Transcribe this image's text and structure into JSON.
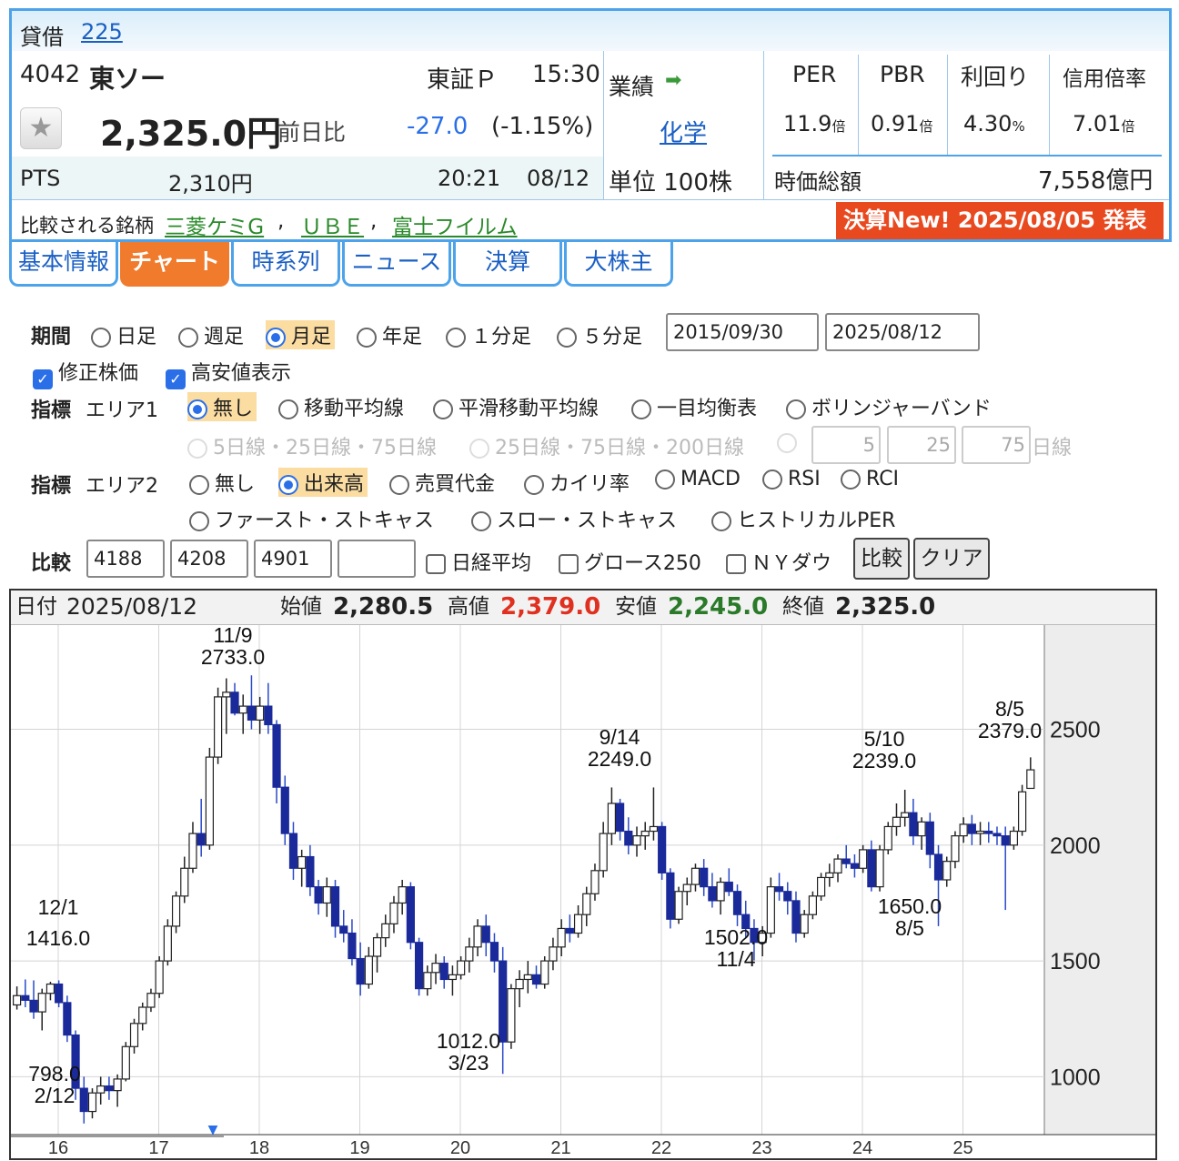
{
  "header": {
    "loan_label": "貸借",
    "index_link": "225",
    "code": "4042",
    "name": "東ソー",
    "market": "東証Ｐ",
    "time": "15:30",
    "price": "2,325.0円",
    "change_label": "前日比",
    "change": "-27.0",
    "change_pct": "(-1.15%)",
    "pts_label": "PTS",
    "pts_price": "2,310円",
    "pts_time": "20:21",
    "pts_date": "08/12",
    "perf_label": "業績",
    "sector": "化学",
    "unit": "単位 100株",
    "per_label": "PER",
    "pbr_label": "PBR",
    "yield_label": "利回り",
    "margin_label": "信用倍率",
    "per": "11.9",
    "pbr": "0.91",
    "yield": "4.30",
    "margin": "7.01",
    "bai": "倍",
    "pct": "%",
    "mcap_label": "時価総額",
    "mcap": "7,558億円",
    "compare_label": "比較される銘柄",
    "peer1": "三菱ケミG",
    "peer2": "ＵＢＥ",
    "peer3": "富士フイルム",
    "sep": ",",
    "earnings": "決算New! 2025/08/05 発表"
  },
  "tabs": [
    "基本情報",
    "チャート",
    "時系列",
    "ニュース",
    "決算",
    "大株主"
  ],
  "controls": {
    "period_label": "期間",
    "periods": [
      "日足",
      "週足",
      "月足",
      "年足",
      "１分足",
      "５分足"
    ],
    "date_from": "2015/09/30",
    "date_to": "2025/08/12",
    "adjusted": "修正株価",
    "highlow": "高安値表示",
    "indicator_label": "指標",
    "area1": "エリア1",
    "area1_opts": [
      "無し",
      "移動平均線",
      "平滑移動平均線",
      "一目均衡表",
      "ボリンジャーバンド"
    ],
    "ma_set1": "5日線・25日線・75日線",
    "ma_set2": "25日線・75日線・200日線",
    "ma1": "5",
    "ma2": "25",
    "ma3": "75",
    "ma_unit": "日線",
    "area2": "エリア2",
    "area2_opts": [
      "無し",
      "出来高",
      "売買代金",
      "カイリ率",
      "MACD",
      "RSI",
      "RCI"
    ],
    "area2_opts2": [
      "ファースト・ストキャス",
      "スロー・ストキャス",
      "ヒストリカルPER"
    ],
    "compare_label": "比較",
    "cmp1": "4188",
    "cmp2": "4208",
    "cmp3": "4901",
    "cmp4": "",
    "nikkei": "日経平均",
    "growth": "グロース250",
    "ny": "ＮＹダウ",
    "compare_btn": "比較",
    "clear_btn": "クリア"
  },
  "ohlc_bar": {
    "date_label": "日付",
    "date": "2025/08/12",
    "open_label": "始値",
    "open": "2,280.5",
    "high_label": "高値",
    "high": "2,379.0",
    "low_label": "安値",
    "low": "2,245.0",
    "close_label": "終値",
    "close": "2,325.0"
  },
  "chart_data": {
    "type": "candlestick",
    "ylim": [
      750,
      2950
    ],
    "yticks": [
      1000,
      1500,
      2000,
      2500
    ],
    "xticks": [
      "16",
      "17",
      "18",
      "19",
      "20",
      "21",
      "22",
      "23",
      "24",
      "25"
    ],
    "annotations": [
      {
        "date": "12/1",
        "value": "1416.0"
      },
      {
        "date": "2/12",
        "value": "798.0"
      },
      {
        "date": "11/9",
        "value": "2733.0"
      },
      {
        "date": "3/23",
        "value": "1012.0"
      },
      {
        "date": "9/14",
        "value": "2249.0"
      },
      {
        "date": "11/4",
        "value": "1502.0"
      },
      {
        "date": "5/10",
        "value": "2239.0"
      },
      {
        "date": "8/5",
        "value": "1650.0"
      },
      {
        "date": "8/5",
        "value": "2379.0"
      }
    ],
    "monthly_ohlc": [
      [
        1310,
        1390,
        1290,
        1350
      ],
      [
        1350,
        1420,
        1300,
        1330
      ],
      [
        1330,
        1416,
        1250,
        1280
      ],
      [
        1280,
        1380,
        1200,
        1360
      ],
      [
        1360,
        1410,
        1330,
        1400
      ],
      [
        1400,
        1416,
        1300,
        1320
      ],
      [
        1320,
        1350,
        1150,
        1180
      ],
      [
        1180,
        1200,
        900,
        950
      ],
      [
        950,
        1000,
        798,
        850
      ],
      [
        850,
        950,
        820,
        930
      ],
      [
        930,
        1000,
        880,
        960
      ],
      [
        960,
        1000,
        900,
        940
      ],
      [
        940,
        1010,
        870,
        990
      ],
      [
        990,
        1150,
        980,
        1130
      ],
      [
        1130,
        1250,
        1100,
        1230
      ],
      [
        1230,
        1320,
        1200,
        1300
      ],
      [
        1300,
        1380,
        1280,
        1360
      ],
      [
        1360,
        1520,
        1340,
        1500
      ],
      [
        1500,
        1680,
        1480,
        1650
      ],
      [
        1650,
        1800,
        1620,
        1780
      ],
      [
        1780,
        1950,
        1750,
        1900
      ],
      [
        1900,
        2100,
        1880,
        2050
      ],
      [
        2050,
        2200,
        1950,
        2000
      ],
      [
        2000,
        2420,
        1980,
        2380
      ],
      [
        2380,
        2680,
        2350,
        2640
      ],
      [
        2640,
        2720,
        2480,
        2660
      ],
      [
        2660,
        2700,
        2560,
        2570
      ],
      [
        2570,
        2650,
        2480,
        2600
      ],
      [
        2600,
        2733,
        2500,
        2540
      ],
      [
        2540,
        2640,
        2480,
        2600
      ],
      [
        2600,
        2700,
        2480,
        2520
      ],
      [
        2520,
        2540,
        2180,
        2250
      ],
      [
        2250,
        2300,
        2000,
        2050
      ],
      [
        2050,
        2100,
        1850,
        1900
      ],
      [
        1900,
        1980,
        1820,
        1950
      ],
      [
        1950,
        2000,
        1780,
        1820
      ],
      [
        1820,
        1850,
        1700,
        1750
      ],
      [
        1750,
        1860,
        1690,
        1820
      ],
      [
        1820,
        1850,
        1600,
        1650
      ],
      [
        1650,
        1720,
        1580,
        1620
      ],
      [
        1620,
        1680,
        1480,
        1510
      ],
      [
        1510,
        1580,
        1350,
        1400
      ],
      [
        1400,
        1560,
        1380,
        1520
      ],
      [
        1520,
        1620,
        1450,
        1600
      ],
      [
        1600,
        1700,
        1560,
        1660
      ],
      [
        1660,
        1780,
        1620,
        1750
      ],
      [
        1750,
        1850,
        1700,
        1820
      ],
      [
        1820,
        1840,
        1550,
        1580
      ],
      [
        1580,
        1600,
        1350,
        1380
      ],
      [
        1380,
        1480,
        1350,
        1450
      ],
      [
        1450,
        1530,
        1400,
        1490
      ],
      [
        1490,
        1520,
        1380,
        1420
      ],
      [
        1420,
        1480,
        1350,
        1440
      ],
      [
        1440,
        1520,
        1420,
        1500
      ],
      [
        1500,
        1600,
        1450,
        1560
      ],
      [
        1560,
        1680,
        1520,
        1650
      ],
      [
        1650,
        1700,
        1520,
        1580
      ],
      [
        1580,
        1620,
        1450,
        1500
      ],
      [
        1500,
        1560,
        1012,
        1150
      ],
      [
        1150,
        1400,
        1120,
        1380
      ],
      [
        1380,
        1460,
        1300,
        1420
      ],
      [
        1420,
        1500,
        1360,
        1440
      ],
      [
        1440,
        1480,
        1380,
        1400
      ],
      [
        1400,
        1520,
        1380,
        1500
      ],
      [
        1500,
        1600,
        1460,
        1560
      ],
      [
        1560,
        1680,
        1520,
        1640
      ],
      [
        1640,
        1700,
        1580,
        1620
      ],
      [
        1620,
        1740,
        1600,
        1700
      ],
      [
        1700,
        1820,
        1650,
        1790
      ],
      [
        1790,
        1920,
        1760,
        1890
      ],
      [
        1890,
        2100,
        1860,
        2050
      ],
      [
        2050,
        2249,
        2000,
        2180
      ],
      [
        2180,
        2200,
        2020,
        2060
      ],
      [
        2060,
        2120,
        1960,
        2000
      ],
      [
        2000,
        2080,
        1950,
        2040
      ],
      [
        2040,
        2100,
        1980,
        2060
      ],
      [
        2060,
        2249,
        2020,
        2080
      ],
      [
        2080,
        2100,
        1850,
        1880
      ],
      [
        1880,
        1900,
        1640,
        1680
      ],
      [
        1680,
        1820,
        1660,
        1800
      ],
      [
        1800,
        1860,
        1740,
        1830
      ],
      [
        1830,
        1920,
        1800,
        1900
      ],
      [
        1900,
        1940,
        1780,
        1820
      ],
      [
        1820,
        1880,
        1730,
        1760
      ],
      [
        1760,
        1860,
        1700,
        1840
      ],
      [
        1840,
        1900,
        1780,
        1800
      ],
      [
        1800,
        1830,
        1650,
        1700
      ],
      [
        1700,
        1760,
        1600,
        1640
      ],
      [
        1640,
        1680,
        1502,
        1580
      ],
      [
        1580,
        1650,
        1520,
        1620
      ],
      [
        1620,
        1860,
        1600,
        1820
      ],
      [
        1820,
        1880,
        1760,
        1800
      ],
      [
        1800,
        1840,
        1700,
        1760
      ],
      [
        1760,
        1800,
        1580,
        1620
      ],
      [
        1620,
        1720,
        1600,
        1700
      ],
      [
        1700,
        1800,
        1680,
        1780
      ],
      [
        1780,
        1880,
        1760,
        1860
      ],
      [
        1860,
        1920,
        1820,
        1880
      ],
      [
        1880,
        1960,
        1840,
        1940
      ],
      [
        1940,
        2000,
        1900,
        1920
      ],
      [
        1920,
        1960,
        1860,
        1900
      ],
      [
        1900,
        2000,
        1880,
        1980
      ],
      [
        1980,
        2020,
        1800,
        1820
      ],
      [
        1820,
        2000,
        1800,
        1980
      ],
      [
        1980,
        2100,
        1960,
        2080
      ],
      [
        2080,
        2180,
        2040,
        2120
      ],
      [
        2120,
        2239,
        2080,
        2140
      ],
      [
        2140,
        2200,
        2000,
        2040
      ],
      [
        2040,
        2120,
        1980,
        2100
      ],
      [
        2100,
        2140,
        1900,
        1960
      ],
      [
        1960,
        2000,
        1650,
        1850
      ],
      [
        1850,
        1950,
        1820,
        1930
      ],
      [
        1930,
        2060,
        1900,
        2040
      ],
      [
        2040,
        2120,
        2010,
        2090
      ],
      [
        2090,
        2130,
        2000,
        2050
      ],
      [
        2050,
        2100,
        2000,
        2060
      ],
      [
        2060,
        2100,
        2010,
        2050
      ],
      [
        2050,
        2080,
        2000,
        2040
      ],
      [
        2040,
        2080,
        1720,
        2000
      ],
      [
        2000,
        2080,
        1980,
        2060
      ],
      [
        2060,
        2260,
        2040,
        2230
      ],
      [
        2245,
        2379,
        2245,
        2325
      ]
    ]
  }
}
